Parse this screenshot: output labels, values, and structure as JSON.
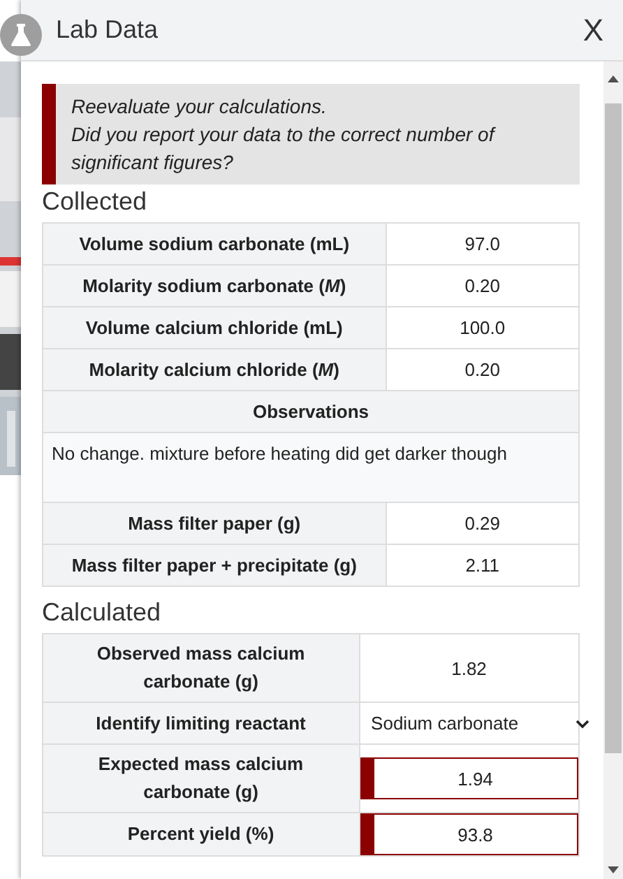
{
  "dialog": {
    "title": "Lab Data",
    "close": "X"
  },
  "alert": {
    "text": "Reevaluate your calculations.\nDid you report your data to the correct number of significant figures?"
  },
  "sections": [
    {
      "heading": "Collected",
      "rows": [
        {
          "kind": "pair",
          "label": "Volume sodium carbonate (mL)",
          "value": "97.0"
        },
        {
          "kind": "pair",
          "label": "Molarity sodium carbonate (*M*)",
          "value": "0.20"
        },
        {
          "kind": "pair",
          "label": "Volume calcium chloride (mL)",
          "value": "100.0"
        },
        {
          "kind": "pair",
          "label": "Molarity calcium chloride (*M*)",
          "value": "0.20"
        },
        {
          "kind": "header",
          "label": "Observations"
        },
        {
          "kind": "note",
          "value": "No change. mixture before heating did get darker though"
        },
        {
          "kind": "pair",
          "label": "Mass filter paper (g)",
          "value": "0.29"
        },
        {
          "kind": "pair",
          "label": "Mass filter paper + precipitate (g)",
          "value": "2.11"
        }
      ]
    },
    {
      "heading": "Calculated",
      "rows": [
        {
          "kind": "pair",
          "label": "Observed mass calcium carbonate (g)",
          "value": "1.82"
        },
        {
          "kind": "select",
          "label": "Identify limiting reactant",
          "value": "Sodium carbonate"
        },
        {
          "kind": "input",
          "label": "Expected mass calcium carbonate (g)",
          "value": "1.94",
          "invalid": true
        },
        {
          "kind": "input",
          "label": "Percent yield (%)",
          "value": "93.8",
          "invalid": true
        }
      ]
    }
  ]
}
